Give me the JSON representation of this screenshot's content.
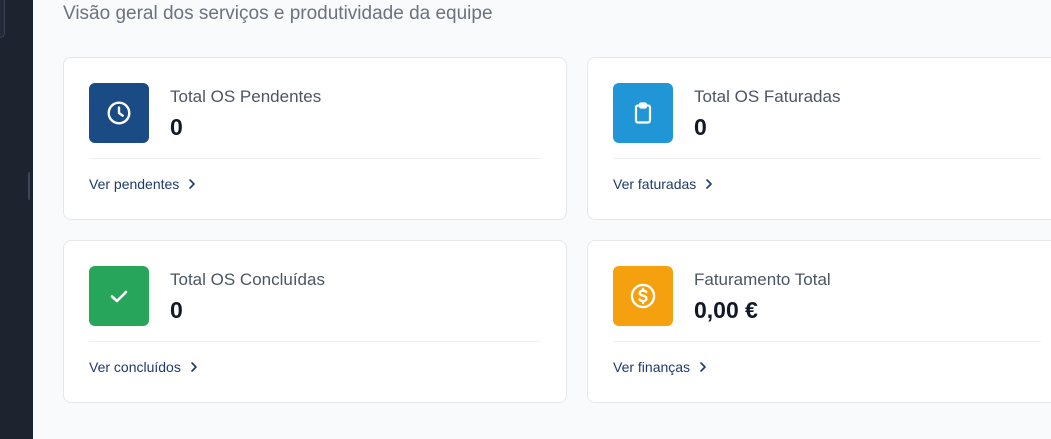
{
  "header": {
    "subtitle": "Visão geral dos serviços e produtividade da equipe"
  },
  "cards": [
    {
      "label": "Total OS Pendentes",
      "value": "0",
      "link": "Ver pendentes",
      "icon": "clock-icon",
      "icon_color": "#1a4b84"
    },
    {
      "label": "Total OS Faturadas",
      "value": "0",
      "link": "Ver faturadas",
      "icon": "clipboard-icon",
      "icon_color": "#2096d7"
    },
    {
      "label": "Total OS Concluídas",
      "value": "0",
      "link": "Ver concluídos",
      "icon": "check-icon",
      "icon_color": "#27a55a"
    },
    {
      "label": "Faturamento Total",
      "value": "0,00 €",
      "link": "Ver finanças",
      "icon": "dollar-coin-icon",
      "icon_color": "#f5a00f"
    }
  ],
  "colors": {
    "link": "#1e3a6e",
    "sidebar": "#1e2330"
  }
}
